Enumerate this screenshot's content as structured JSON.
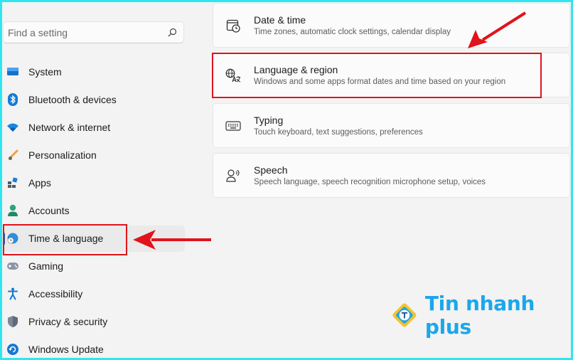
{
  "search": {
    "placeholder": "Find a setting"
  },
  "sidebar": {
    "items": [
      {
        "label": "System",
        "icon": "monitor-icon"
      },
      {
        "label": "Bluetooth & devices",
        "icon": "bluetooth-icon"
      },
      {
        "label": "Network & internet",
        "icon": "wifi-icon"
      },
      {
        "label": "Personalization",
        "icon": "brush-icon"
      },
      {
        "label": "Apps",
        "icon": "apps-icon"
      },
      {
        "label": "Accounts",
        "icon": "person-icon"
      },
      {
        "label": "Time & language",
        "icon": "globe-clock-icon",
        "active": true
      },
      {
        "label": "Gaming",
        "icon": "gamepad-icon"
      },
      {
        "label": "Accessibility",
        "icon": "accessibility-icon"
      },
      {
        "label": "Privacy & security",
        "icon": "shield-icon"
      },
      {
        "label": "Windows Update",
        "icon": "update-icon"
      }
    ]
  },
  "cards": [
    {
      "title": "Date & time",
      "desc": "Time zones, automatic clock settings, calendar display",
      "icon": "calendar-clock-icon"
    },
    {
      "title": "Language & region",
      "desc": "Windows and some apps format dates and time based on your region",
      "icon": "language-icon"
    },
    {
      "title": "Typing",
      "desc": "Touch keyboard, text suggestions, preferences",
      "icon": "keyboard-icon"
    },
    {
      "title": "Speech",
      "desc": "Speech language, speech recognition microphone setup, voices",
      "icon": "speech-icon"
    }
  ],
  "watermark": {
    "text": "Tin nhanh plus"
  },
  "colors": {
    "accent": "#0067c0",
    "annotation": "#e0141a",
    "frame": "#2fe6f0",
    "logo": "#1aa7ec"
  }
}
